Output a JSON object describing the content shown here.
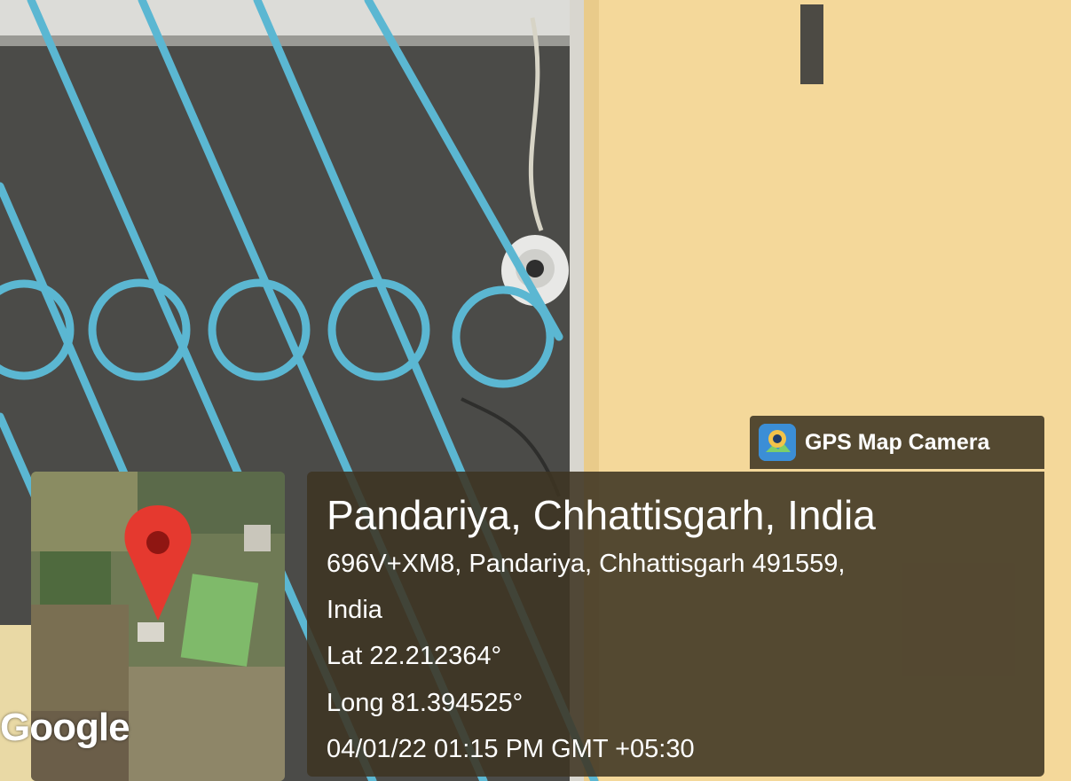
{
  "badge": {
    "logo_icon": "gps-map-camera-logo",
    "title": "GPS Map Camera"
  },
  "map": {
    "attribution": "Google",
    "marker_icon": "location-pin-icon",
    "marker_color": "#e5392f"
  },
  "location": {
    "place": "Pandariya, Chhattisgarh, India",
    "address_line1": "696V+XM8, Pandariya, Chhattisgarh 491559,",
    "address_line2": "India",
    "latitude": "Lat 22.212364°",
    "longitude": "Long 81.394525°",
    "datetime": "04/01/22 01:15 PM GMT +05:30"
  },
  "colors": {
    "panel_bg": "#3e3422",
    "grille": "#5bb7d2",
    "wall": "#f4d89a"
  }
}
